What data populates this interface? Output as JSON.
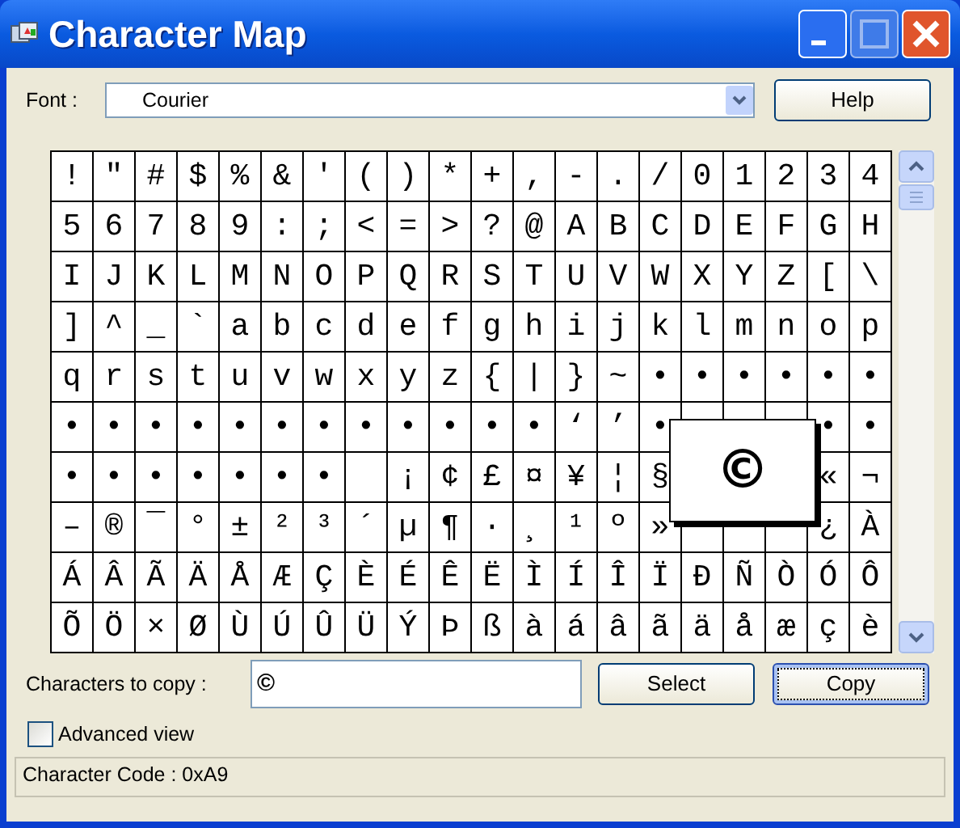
{
  "window": {
    "title": "Character Map"
  },
  "font": {
    "label": "Font :",
    "value": "Courier"
  },
  "help_button": "Help",
  "grid": {
    "rows": [
      [
        "!",
        "\"",
        "#",
        "$",
        "%",
        "&",
        "'",
        "(",
        ")",
        "*",
        "+",
        ",",
        "-",
        ".",
        "/",
        "0",
        "1",
        "2",
        "3",
        "4"
      ],
      [
        "5",
        "6",
        "7",
        "8",
        "9",
        ":",
        ";",
        "<",
        "=",
        ">",
        "?",
        "@",
        "A",
        "B",
        "C",
        "D",
        "E",
        "F",
        "G",
        "H"
      ],
      [
        "I",
        "J",
        "K",
        "L",
        "M",
        "N",
        "O",
        "P",
        "Q",
        "R",
        "S",
        "T",
        "U",
        "V",
        "W",
        "X",
        "Y",
        "Z",
        "[",
        "\\"
      ],
      [
        "]",
        "^",
        "_",
        "`",
        "a",
        "b",
        "c",
        "d",
        "e",
        "f",
        "g",
        "h",
        "i",
        "j",
        "k",
        "l",
        "m",
        "n",
        "o",
        "p"
      ],
      [
        "q",
        "r",
        "s",
        "t",
        "u",
        "v",
        "w",
        "x",
        "y",
        "z",
        "{",
        "|",
        "}",
        "~",
        "•",
        "•",
        "•",
        "•",
        "•",
        "•"
      ],
      [
        "•",
        "•",
        "•",
        "•",
        "•",
        "•",
        "•",
        "•",
        "•",
        "•",
        "•",
        "•",
        "‘",
        "’",
        "•",
        null,
        null,
        null,
        "•",
        "•"
      ],
      [
        "•",
        "•",
        "•",
        "•",
        "•",
        "•",
        "•",
        null,
        "¡",
        "¢",
        "£",
        "¤",
        "¥",
        "¦",
        "§",
        null,
        null,
        null,
        "«",
        "¬"
      ],
      [
        "–",
        "®",
        "¯",
        "°",
        "±",
        "²",
        "³",
        "´",
        "µ",
        "¶",
        "·",
        "¸",
        "¹",
        "º",
        "»",
        null,
        null,
        null,
        "¿",
        "À"
      ],
      [
        "Á",
        "Â",
        "Ã",
        "Ä",
        "Å",
        "Æ",
        "Ç",
        "È",
        "É",
        "Ê",
        "Ë",
        "Ì",
        "Í",
        "Î",
        "Ï",
        "Ð",
        "Ñ",
        "Ò",
        "Ó",
        "Ô"
      ],
      [
        "Õ",
        "Ö",
        "×",
        "Ø",
        "Ù",
        "Ú",
        "Û",
        "Ü",
        "Ý",
        "Þ",
        "ß",
        "à",
        "á",
        "â",
        "ã",
        "ä",
        "å",
        "æ",
        "ç",
        "è"
      ]
    ],
    "magnified": "©"
  },
  "copy": {
    "label": "Characters to copy :",
    "value": "©"
  },
  "buttons": [
    {
      "label": "Select",
      "focused": false
    },
    {
      "label": "Copy",
      "focused": true
    }
  ],
  "advanced_view": {
    "label": "Advanced view",
    "checked": false
  },
  "status_bar": "Character Code : 0xA9"
}
